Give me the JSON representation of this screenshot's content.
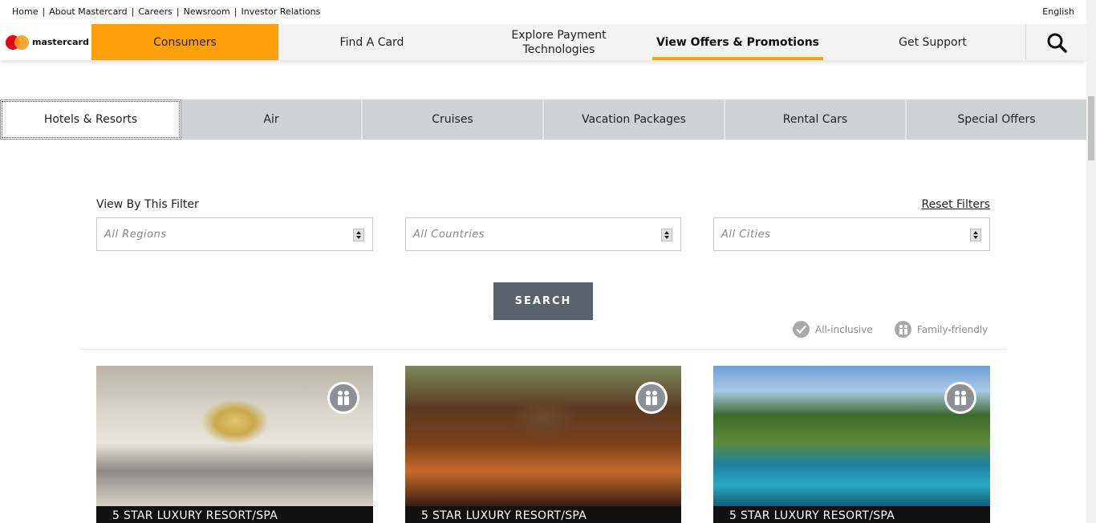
{
  "utility": {
    "links": [
      "Home",
      "About Mastercard",
      "Careers",
      "Newsroom",
      "Investor Relations"
    ],
    "language": "English"
  },
  "brand": {
    "name": "mastercard"
  },
  "nav": {
    "items": [
      "Consumers",
      "Find A Card",
      "Explore Payment Technologies",
      "View Offers & Promotions",
      "Get Support"
    ],
    "search_icon": "search-icon",
    "accent_color": "#ff9f0a"
  },
  "tabs": [
    "Hotels & Resorts",
    "Air",
    "Cruises",
    "Vacation Packages",
    "Rental Cars",
    "Special Offers"
  ],
  "filter": {
    "label": "View By This Filter",
    "reset": "Reset Filters",
    "regions_placeholder": "All Regions",
    "countries_placeholder": "All Countries",
    "cities_placeholder": "All Cities",
    "search": "SEARCH"
  },
  "legend": {
    "all_inclusive": "All-inclusive",
    "family_friendly": "Family-friendly"
  },
  "cards": [
    {
      "caption": "5 STAR LUXURY RESORT/SPA"
    },
    {
      "caption": "5 STAR LUXURY RESORT/SPA"
    },
    {
      "caption": "5 STAR LUXURY RESORT/SPA"
    }
  ]
}
